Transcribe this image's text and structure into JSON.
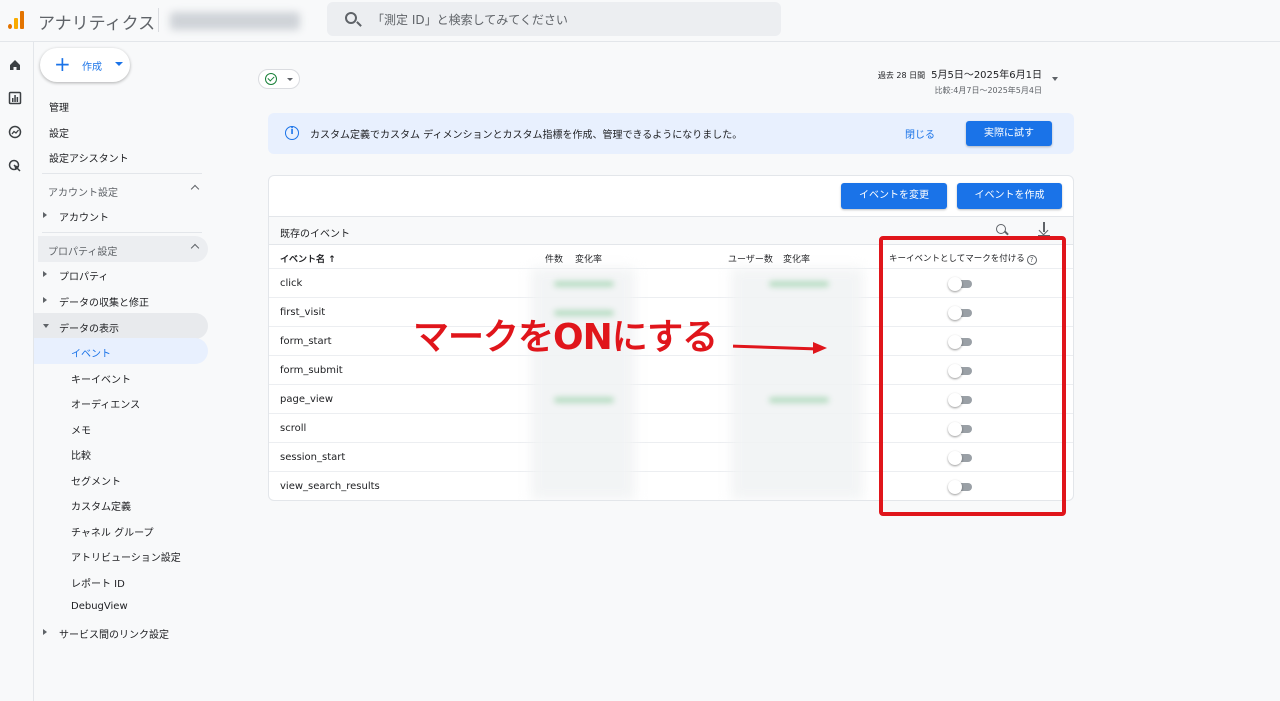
{
  "header": {
    "app_title": "アナリティクス",
    "search_placeholder": "「測定 ID」と検索してみてください"
  },
  "rail": {
    "icons": [
      "home-icon",
      "reports-icon",
      "explore-icon",
      "advertising-icon"
    ]
  },
  "sidebar": {
    "create_label": "作成",
    "top_items": [
      "管理",
      "設定",
      "設定アシスタント"
    ],
    "account_section": "アカウント設定",
    "account_item": "アカウント",
    "property_section": "プロパティ設定",
    "property_items": [
      "プロパティ",
      "データの収集と修正",
      "データの表示"
    ],
    "display_subitems": [
      "イベント",
      "キーイベント",
      "オーディエンス",
      "メモ",
      "比較",
      "セグメント",
      "カスタム定義",
      "チャネル グループ",
      "アトリビューション設定",
      "レポート ID",
      "DebugView"
    ],
    "link_item": "サービス間のリンク設定"
  },
  "date": {
    "prefix": "過去 28 日間",
    "range": "5月5日〜2025年6月1日",
    "compare": "比較:4月7日〜2025年5月4日"
  },
  "banner": {
    "message": "カスタム定義でカスタム ディメンションとカスタム指標を作成、管理できるようになりました。",
    "close_label": "閉じる",
    "try_label": "実際に試す"
  },
  "events": {
    "modify_button": "イベントを変更",
    "create_button": "イベントを作成",
    "table_title": "既存のイベント",
    "columns": {
      "name": "イベント名 ↑",
      "count": "件数",
      "count_change": "変化率",
      "users": "ユーザー数",
      "users_change": "変化率",
      "key_event": "キーイベントとしてマークを付ける"
    },
    "rows": [
      "click",
      "first_visit",
      "form_start",
      "form_submit",
      "page_view",
      "scroll",
      "session_start",
      "view_search_results"
    ]
  },
  "annotation": {
    "text": "マークをONにする",
    "color": "#e0151b"
  }
}
